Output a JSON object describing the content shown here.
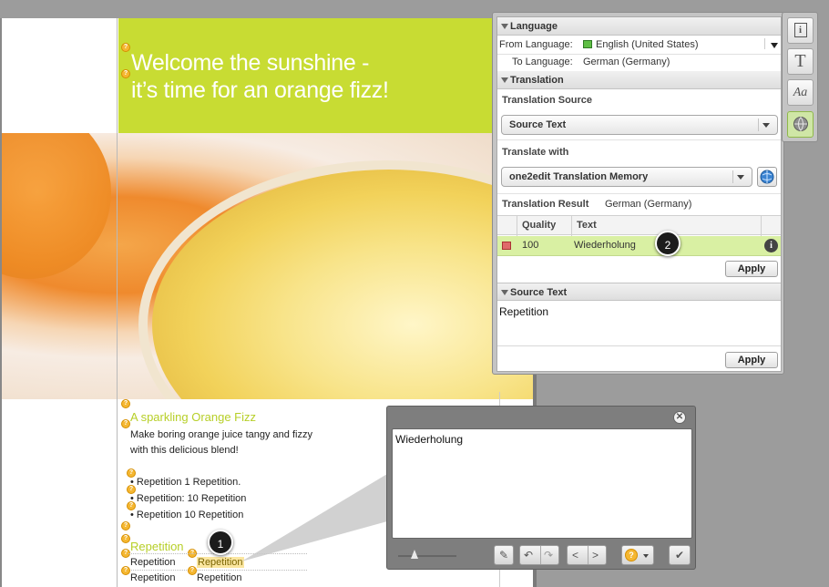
{
  "document": {
    "banner": {
      "line1": "Welcome the sunshine -",
      "line2": "it’s time for an orange fizz!",
      "color": "#c8dc33"
    },
    "section_heading": "A sparkling Orange Fizz",
    "intro_line1": "Make boring orange juice tangy and fizzy",
    "intro_line2": "with this delicious blend!",
    "bullets": [
      "Repetition 1 Repetition.",
      "Repetition: 10 Repetition",
      "Repetition 10 Repetition"
    ],
    "sub_heading": "Repetition",
    "rows": [
      {
        "source": "Repetition",
        "target": "Repetition"
      },
      {
        "source": "Repetition",
        "target": "Repetition"
      }
    ],
    "marker_icon": "question-marker-icon"
  },
  "steps": {
    "step1": "1",
    "step2": "2"
  },
  "panel": {
    "language_header": "Language",
    "from_label": "From Language:",
    "from_value": "English (United States)",
    "to_label": "To Language:",
    "to_value": "German (Germany)",
    "translation_header": "Translation",
    "translation_source_label": "Translation Source",
    "translation_source_value": "Source Text",
    "translate_with_label": "Translate with",
    "translate_with_value": "one2edit Translation Memory",
    "result_label": "Translation Result",
    "result_language": "German (Germany)",
    "table": {
      "headers": [
        "Quality",
        "Text"
      ],
      "rows": [
        {
          "quality": "100",
          "text": "Wiederholung"
        }
      ],
      "row_highlight": "#d9f0a3"
    },
    "apply_label": "Apply",
    "source_text_header": "Source Text",
    "source_text_value": "Repetition",
    "apply_label_2": "Apply"
  },
  "toolbar": {
    "items": [
      {
        "icon": "info-icon",
        "glyph": "i"
      },
      {
        "icon": "text-icon",
        "glyph": "T"
      },
      {
        "icon": "font-style-icon",
        "glyph": "Aa"
      },
      {
        "icon": "globe-icon",
        "glyph": "⊕",
        "active": true
      }
    ]
  },
  "popup": {
    "text": "Wiederholung",
    "close_icon": "close-icon"
  }
}
